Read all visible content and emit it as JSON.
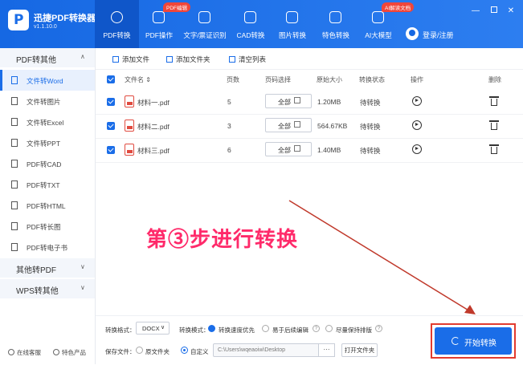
{
  "app": {
    "name": "迅捷PDF转换器",
    "version": "v1.1.10.0"
  },
  "tabs": [
    {
      "label": "PDF转换"
    },
    {
      "label": "PDF操作",
      "badge": "PDF编辑"
    },
    {
      "label": "文字/票证识别"
    },
    {
      "label": "CAD转换"
    },
    {
      "label": "图片转换"
    },
    {
      "label": "特色转换"
    },
    {
      "label": "AI大模型",
      "badge": "AI解读文档"
    }
  ],
  "user": {
    "login_label": "登录/注册"
  },
  "window": {
    "minimize": "—",
    "close": "✕"
  },
  "sidebar": {
    "cat_pdf_to_other": "PDF转其他",
    "items": [
      {
        "label": "文件转Word"
      },
      {
        "label": "文件转图片"
      },
      {
        "label": "文件转Excel"
      },
      {
        "label": "文件转PPT"
      },
      {
        "label": "PDF转CAD"
      },
      {
        "label": "PDF转TXT"
      },
      {
        "label": "PDF转HTML"
      },
      {
        "label": "PDF转长图"
      },
      {
        "label": "PDF转电子书"
      }
    ],
    "cat_other_to_pdf": "其他转PDF",
    "cat_wps": "WPS转其他",
    "footer": {
      "support": "在线客服",
      "featured": "特色产品"
    }
  },
  "toolbar": {
    "add_file": "添加文件",
    "add_folder": "添加文件夹",
    "clear_list": "清空列表"
  },
  "table": {
    "headers": {
      "name": "文件名 ⇕",
      "pages": "页数",
      "page_select": "页码选择",
      "size": "原始大小",
      "status": "转换状态",
      "action": "操作",
      "delete": "删除"
    },
    "rows": [
      {
        "name": "材料一.pdf",
        "pages": "5",
        "page_select": "全部",
        "size": "1.20MB",
        "status": "待转换"
      },
      {
        "name": "材料二.pdf",
        "pages": "3",
        "page_select": "全部",
        "size": "564.67KB",
        "status": "待转换"
      },
      {
        "name": "材料三.pdf",
        "pages": "6",
        "page_select": "全部",
        "size": "1.40MB",
        "status": "待转换"
      }
    ]
  },
  "overlay_text": "第③步进行转换",
  "bottom": {
    "format_label": "转换格式：",
    "format_value": "DOCX",
    "mode_label": "转换模式：",
    "mode_options": [
      "转换速度优先",
      "易于后续编辑",
      "尽量保持排版"
    ],
    "save_label": "保存文件：",
    "save_options": [
      "原文件夹",
      "自定义"
    ],
    "path": "C:\\Users\\wqeaoiw\\Desktop",
    "browse": "···",
    "open_folder": "打开文件夹"
  },
  "start_button": "开始转换",
  "colors": {
    "primary": "#1a6de8",
    "highlight": "#e23b2f",
    "overlay_text": "#ff2a6a"
  }
}
